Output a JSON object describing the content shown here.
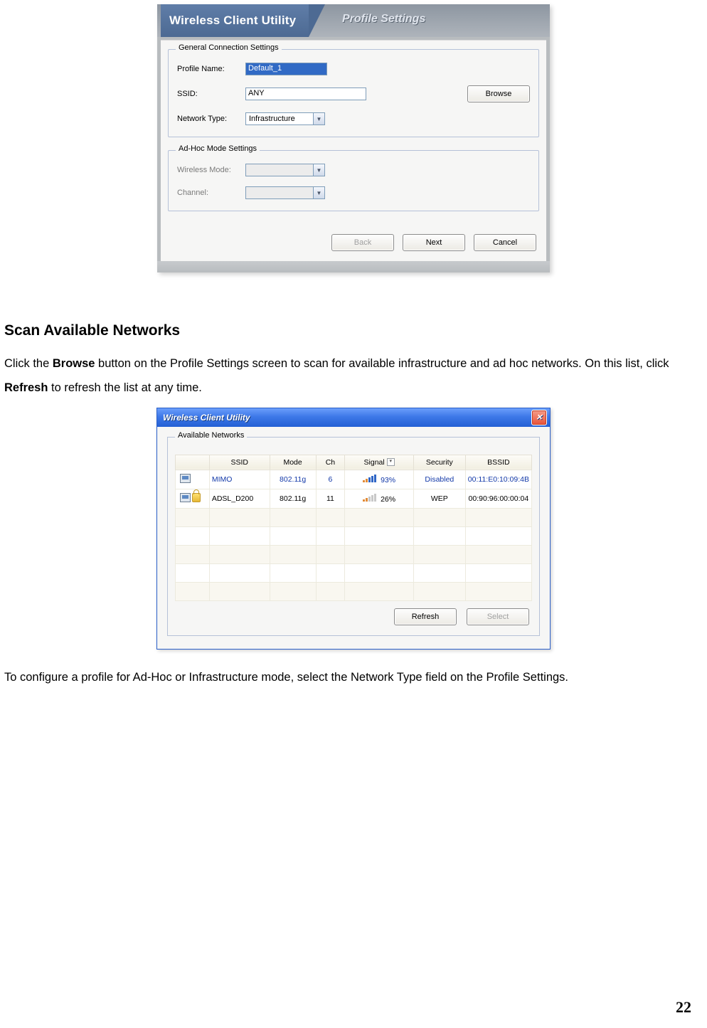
{
  "page_number": "22",
  "dialog1": {
    "app_title": "Wireless Client Utility",
    "tab_title": "Profile Settings",
    "group1": {
      "legend": "General Connection Settings",
      "profile_name_label": "Profile Name:",
      "profile_name_value": "Default_1",
      "ssid_label": "SSID:",
      "ssid_value": "ANY",
      "browse_label": "Browse",
      "network_type_label": "Network Type:",
      "network_type_value": "Infrastructure"
    },
    "group2": {
      "legend": "Ad-Hoc Mode Settings",
      "wireless_mode_label": "Wireless Mode:",
      "channel_label": "Channel:"
    },
    "buttons": {
      "back": "Back",
      "next": "Next",
      "cancel": "Cancel"
    }
  },
  "section": {
    "heading": "Scan Available Networks",
    "p1a": "Click the ",
    "p1b": "Browse",
    "p1c": " button on the Profile Settings screen to scan for available infrastructure and ad hoc networks. On this list, click ",
    "p1d": "Refresh",
    "p1e": " to refresh the list at any time.",
    "p2": "To configure a profile for Ad-Hoc or Infrastructure mode, select the Network Type field on the Profile Settings."
  },
  "dialog2": {
    "title": "Wireless Client Utility",
    "legend": "Available Networks",
    "headers": {
      "ssid": "SSID",
      "mode": "Mode",
      "ch": "Ch",
      "signal": "Signal",
      "security": "Security",
      "bssid": "BSSID"
    },
    "rows": [
      {
        "ssid": "MIMO",
        "mode": "802.11g",
        "ch": "6",
        "signal": "93%",
        "security": "Disabled",
        "bssid": "00:11:E0:10:09:4B",
        "secure": false,
        "strength": "high"
      },
      {
        "ssid": "ADSL_D200",
        "mode": "802.11g",
        "ch": "11",
        "signal": "26%",
        "security": "WEP",
        "bssid": "00:90:96:00:00:04",
        "secure": true,
        "strength": "low"
      }
    ],
    "buttons": {
      "refresh": "Refresh",
      "select": "Select"
    }
  }
}
